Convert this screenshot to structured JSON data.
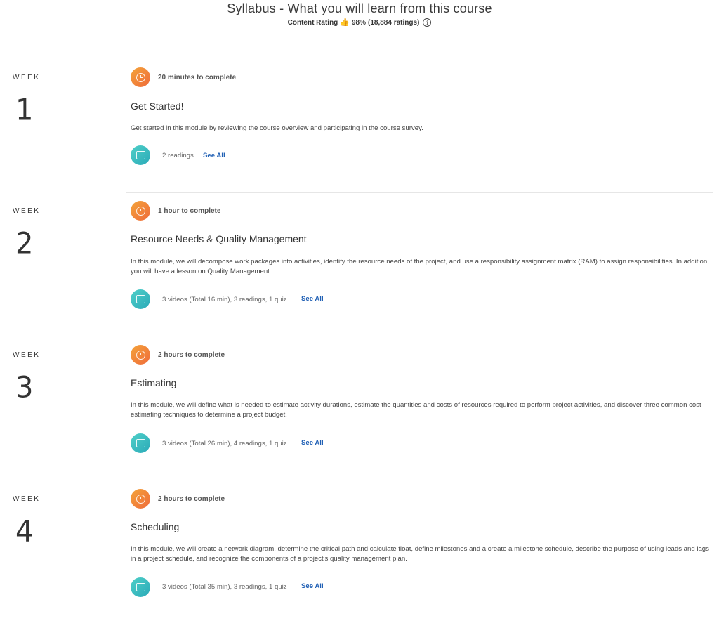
{
  "header": {
    "title": "Syllabus - What you will learn from this course",
    "rating_label": "Content Rating",
    "rating_percent": "98%",
    "rating_count": "(18,884 ratings)"
  },
  "weeks": [
    {
      "label": "WEEK",
      "number": "1",
      "duration": "20 minutes to complete",
      "title": "Get Started!",
      "description": "Get started in this module by reviewing the course overview and participating in the course survey.",
      "materials": "2 readings",
      "see_all": "See All"
    },
    {
      "label": "WEEK",
      "number": "2",
      "duration": "1 hour to complete",
      "title": "Resource Needs & Quality Management",
      "description": "In this module, we will decompose work packages into activities, identify the resource needs of the project, and use a responsibility assignment matrix (RAM) to assign responsibilities. In addition, you will have a lesson on Quality Management.",
      "materials": "3 videos (Total 16 min), 3 readings, 1 quiz",
      "see_all": "See All"
    },
    {
      "label": "WEEK",
      "number": "3",
      "duration": "2 hours to complete",
      "title": "Estimating",
      "description": "In this module, we will define what is needed to estimate activity durations, estimate the quantities and costs of resources required to perform project activities, and discover three common cost estimating techniques to determine a project budget.",
      "materials": "3 videos (Total 26 min), 4 readings, 1 quiz",
      "see_all": "See All"
    },
    {
      "label": "WEEK",
      "number": "4",
      "duration": "2 hours to complete",
      "title": "Scheduling",
      "description": "In this module, we will create a network diagram, determine the critical path and calculate float, define milestones and a create a milestone schedule, describe the purpose of using leads and lags in a project schedule, and recognize the components of a project's quality management plan.",
      "materials": "3 videos (Total 35 min), 3 readings, 1 quiz",
      "see_all": "See All"
    }
  ],
  "icons": {
    "rating": "thumbs-up-icon",
    "info": "info-icon",
    "duration": "clock-icon",
    "materials": "book-icon"
  },
  "colors": {
    "clock_badge": "#ef7a3a",
    "book_badge": "#33b5bc",
    "link": "#1f5fb4"
  }
}
